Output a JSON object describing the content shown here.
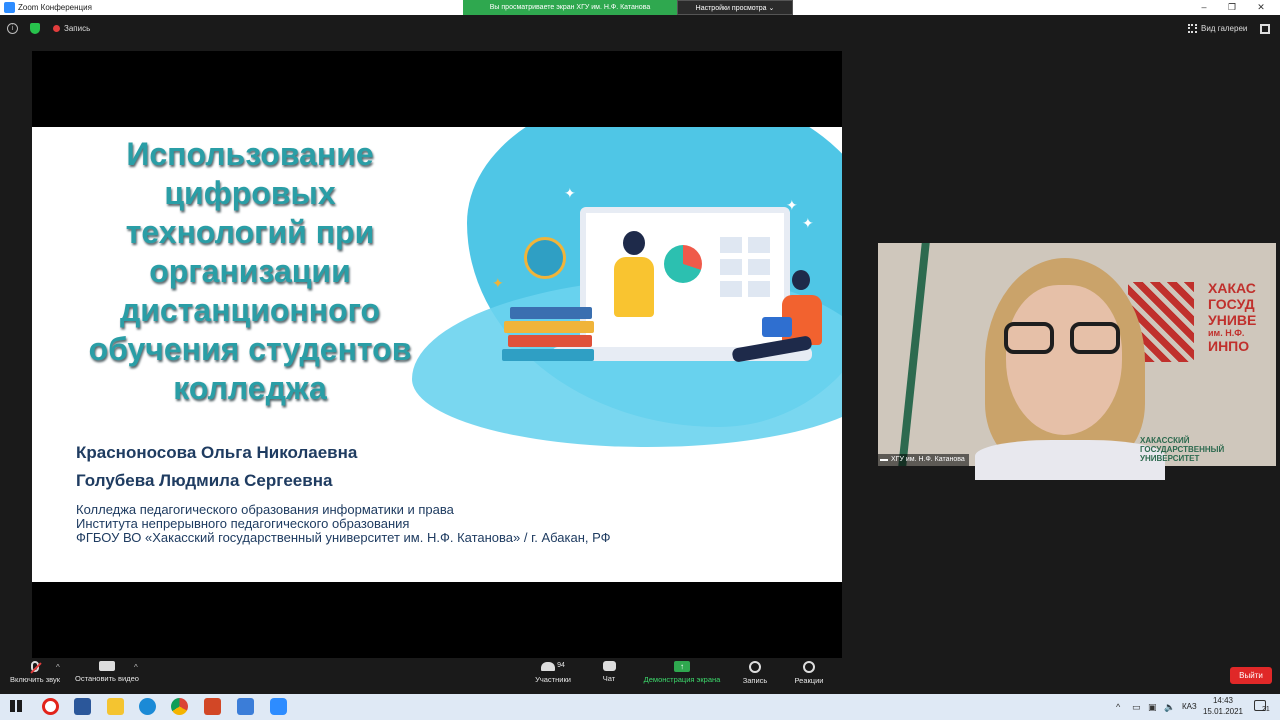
{
  "window": {
    "title": "Zoom Конференция",
    "share_banner": "Вы просматриваете экран ХГУ им. Н.Ф. Катанова",
    "view_settings": "Настройки просмотра ⌄",
    "controls": [
      "–",
      "❐",
      "✕"
    ]
  },
  "top_bar": {
    "info": "i",
    "recording_label": "Запись",
    "gallery_view_label": "Вид галереи"
  },
  "slide": {
    "title_lines": [
      "Использование",
      "цифровых",
      "технологий при",
      "организации",
      "дистанционного",
      "обучения студентов",
      "колледжа"
    ],
    "authors": [
      "Красноносова Ольга Николаевна",
      "Голубева Людмила Сергеевна"
    ],
    "institution_lines": [
      "Колледжа педагогического образования информатики и права",
      "Института непрерывного педагогического образования",
      "ФГБОУ ВО «Хакасский государственный университет им. Н.Ф. Катанова» / г. Абакан, РФ"
    ]
  },
  "video": {
    "participant_name": "ХГУ им. Н.Ф. Катанова",
    "logo_text_top": [
      "ХАКАС",
      "ГОСУД",
      "УНИВЕ",
      "им. Н.Ф.",
      "ИНПО"
    ],
    "logo_text_bottom": [
      "ХАКАССКИЙ",
      "ГОСУДАРСТВЕННЫЙ",
      "УНИВЕРСИТЕТ"
    ]
  },
  "toolbar": {
    "mute_label": "Включить звук",
    "video_label": "Остановить видео",
    "participants_label": "Участники",
    "participants_count": "94",
    "chat_label": "Чат",
    "share_label": "Демонстрация экрана",
    "record_label": "Запись",
    "reactions_label": "Реакции",
    "leave_label": "Выйти",
    "caret": "^"
  },
  "taskbar": {
    "language": "КАЗ",
    "time": "14:43",
    "date": "15.01.2021",
    "notifications": "21",
    "tray_chevron": "^"
  },
  "colors": {
    "zoom_green": "#2fa84f",
    "leave_red": "#e02828",
    "slide_title": "#2a9ea6",
    "slide_text": "#1f3c61"
  }
}
